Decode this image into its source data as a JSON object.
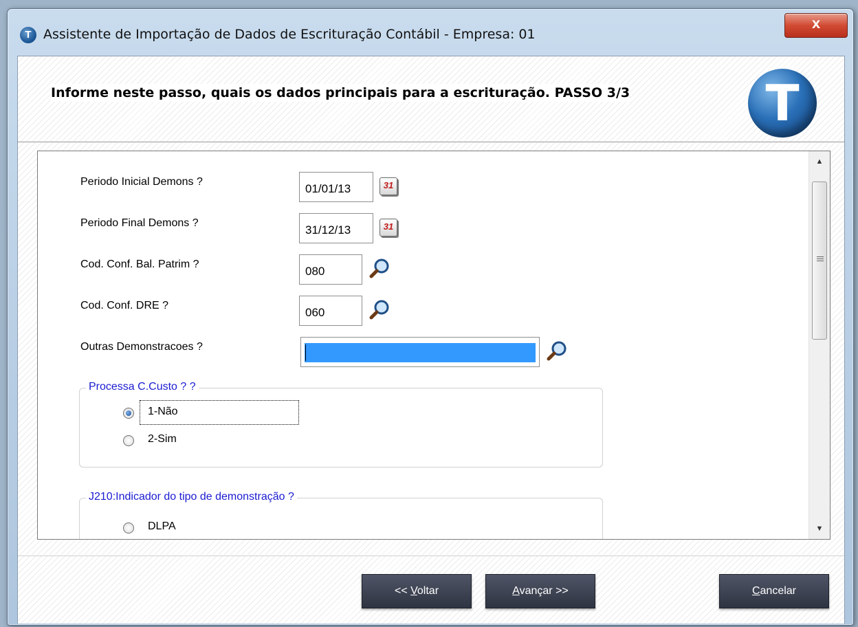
{
  "window": {
    "title": "Assistente de Importação de Dados de Escrituração Contábil - Empresa: 01",
    "close_label": "X"
  },
  "header": {
    "text": "Informe neste passo, quais os dados principais para a escrituração. PASSO 3/3",
    "logo_letter": "T"
  },
  "fields": {
    "periodo_inicial": {
      "label": "Periodo Inicial Demons ?",
      "value": "01/01/13"
    },
    "periodo_final": {
      "label": "Periodo Final Demons ?",
      "value": "31/12/13"
    },
    "cod_bal_patrim": {
      "label": "Cod. Conf. Bal. Patrim ?",
      "value": "080"
    },
    "cod_dre": {
      "label": "Cod. Conf. DRE ?",
      "value": "060"
    },
    "outras_demonstracoes": {
      "label": "Outras Demonstracoes ?",
      "value": ""
    }
  },
  "calendar_icon_text": "31",
  "groups": {
    "processa_ccusto": {
      "legend": "Processa C.Custo ? ?",
      "options": [
        "1-Não",
        "2-Sim"
      ],
      "selected": "1-Não"
    },
    "j210": {
      "legend": "J210:Indicador do tipo de demonstração ?",
      "options": [
        "DLPA"
      ]
    }
  },
  "buttons": {
    "voltar_prefix": "<< ",
    "voltar_accel": "V",
    "voltar_rest": "oltar",
    "avancar_accel": "A",
    "avancar_rest": "vançar >>",
    "cancelar_accel": "C",
    "cancelar_rest": "ancelar"
  }
}
